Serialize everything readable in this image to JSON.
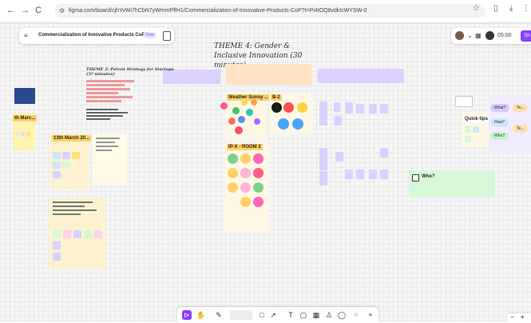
{
  "browser": {
    "back": "←",
    "forward": "→",
    "reload": "C",
    "url": "figma.com/board/cjhYvWi7hCbN7yWmmPffH1/Commercialization-of-Innovative-Products-CoP?t=Pi4tOQ8vdkIcWYSW-0",
    "star": "☆"
  },
  "filebar": {
    "menu_icon": "≡",
    "name": "Commercialization of Innovative Products CoP",
    "badge": "Free"
  },
  "topright": {
    "time": "05:00",
    "share": "Sh"
  },
  "canvas": {
    "theme4_title": "THEME 4: Gender & Inclusive Innovation (30 minutes)",
    "theme2_title": "THEME 2: Patent Strategy for Startups (3? minutes)",
    "weather_label": "Weather Sunny ...",
    "b2_label": "B-2",
    "ipx_label": "IP-X - ROOM 2",
    "date_label": "13th March 20...",
    "left_label": "th Marc...",
    "quick_tips": "Quick tips",
    "what": "What?",
    "how": "How?",
    "who": "Who?",
    "te1": "Te...",
    "te2": "Te...",
    "who_widget": "Who?"
  },
  "toolbar": {
    "move": "⊳",
    "hand": "✋",
    "pen": "✎",
    "shape": "□",
    "text": "T",
    "sticky": "▢",
    "table": "▦",
    "stamp": "♙",
    "comment": "◯",
    "more": "⁘",
    "plus": "+"
  },
  "zoom": {
    "minus": "−",
    "plus": "+"
  }
}
